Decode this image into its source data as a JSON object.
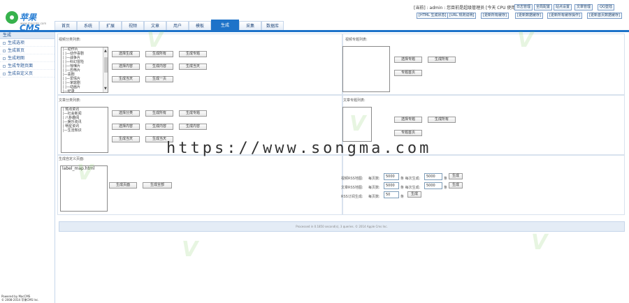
{
  "header": {
    "logo_text": "苹果CMS",
    "logo_sub": "www.maccms.com",
    "user_info": "[当前] : admin : 您目前是超级管理员 [今天 CPU 使用率]",
    "top_buttons": [
      "日志管理",
      "全局配置",
      "站点设置",
      "文章管理",
      "QQ登陆"
    ],
    "top_buttons2": [
      "[HTML 生成状态]",
      "[URL 规则说明]",
      "[更新所有缓存]",
      "[更新数据缓存]",
      "[更新所有缓存操作]",
      "[更新首页数据缓存]"
    ],
    "tabs": [
      "首页",
      "系统",
      "扩展",
      "视频",
      "文章",
      "用户",
      "模板",
      "生成",
      "采集",
      "数据库"
    ],
    "active_tab": "生成"
  },
  "sidebar": {
    "head": "生成",
    "items": [
      "生成选项",
      "生成首页",
      "生成地图",
      "生成专题页面",
      "生成自定义页"
    ],
    "powered": [
      "Powered by MacCMS",
      "© 2008-2014 苹果CMS Inc."
    ]
  },
  "video_section": {
    "label": "视频分类列表:",
    "options": [
      "|—动作片",
      "|  |—动作喜剧",
      "|  |—战争片",
      "|  |—科幻冒险",
      "|  |—惊悚片",
      "|  |—恐怖片",
      "|—喜剧",
      "|  |—爱情片",
      "|  |—家庭剧",
      "|  |—动画片",
      "|—纪录"
    ],
    "buttons": [
      "选择生成",
      "生成所有",
      "生成专题",
      "选择内容",
      "生成内容",
      "生成当天",
      "生成当天",
      "生成一页"
    ],
    "topic_label": "视频专题列表:",
    "topic_buttons": [
      "选择专题",
      "生成所有",
      "专题首页"
    ]
  },
  "article_section": {
    "label": "文章分类列表:",
    "options": [
      "|  热点资讯",
      "|—社会新闻",
      "|  八卦趣闻",
      "|—娱乐资讯",
      "|  明星资讯",
      "|—生活知识"
    ],
    "buttons": [
      "选择分类",
      "生成所有",
      "生成专题",
      "选择内容",
      "生成内容",
      "生成内容",
      "生成当天",
      "生成当天"
    ],
    "topic_label": "文章专题列表:",
    "topic_buttons": [
      "选择专题",
      "生成所有",
      "专题首页"
    ]
  },
  "custom_section": {
    "label": "生成自定义页面:",
    "input_value": "label_map.html",
    "buttons": [
      "生成页面",
      "生成全部"
    ]
  },
  "map_section": {
    "rows": [
      {
        "label": "视频RSS地图:",
        "pre": "每页数:",
        "value": "5000",
        "mid": "条 每次生成:",
        "value2": "5000",
        "suffix": "条",
        "btn": "生成"
      },
      {
        "label": "文章RSS地图:",
        "pre": "每页数:",
        "value": "5000",
        "mid": "条 每次生成:",
        "value2": "5000",
        "suffix": "条",
        "btn": "生成"
      },
      {
        "label": "RSS订阅生成:",
        "pre": "每页数:",
        "value": "50",
        "suffix": "条",
        "btn": "生成"
      }
    ]
  },
  "footer": "Processed in 0.1850 second(s), 3 queries. © 2014 Apple Cms Inc.",
  "watermark": "https://www.songma.com"
}
